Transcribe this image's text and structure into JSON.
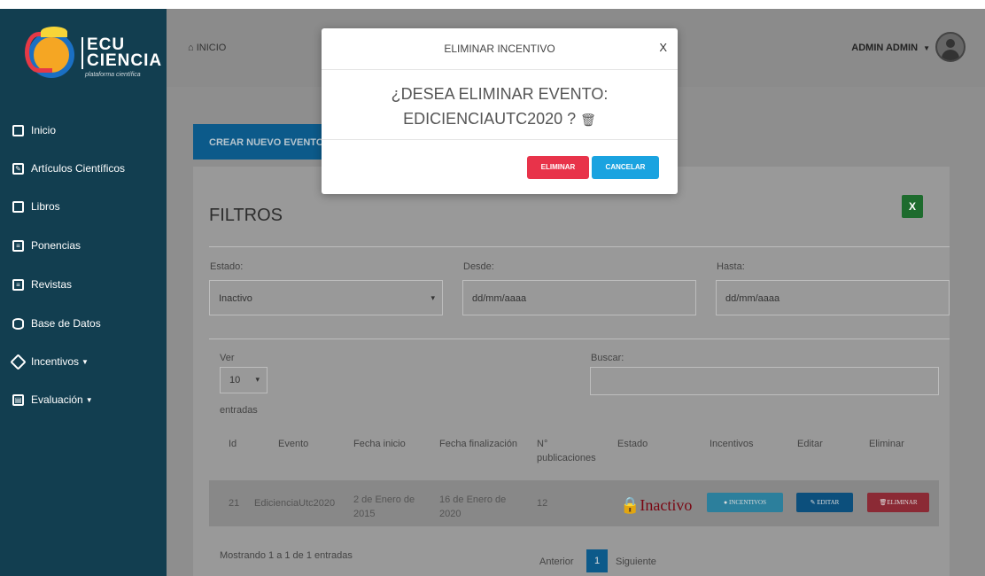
{
  "sidebar": {
    "logo_text": "ECU\nCIENCIA",
    "logo_sub": "plataforma científica",
    "items": [
      {
        "label": "Inicio",
        "icon": "square-icon"
      },
      {
        "label": "Artículos Científicos",
        "icon": "edit-icon"
      },
      {
        "label": "Libros",
        "icon": "book-icon"
      },
      {
        "label": "Ponencias",
        "icon": "newspaper-icon"
      },
      {
        "label": "Revistas",
        "icon": "document-icon"
      },
      {
        "label": "Base de Datos",
        "icon": "database-icon"
      },
      {
        "label": "Incentivos",
        "icon": "tag-icon"
      },
      {
        "label": "Evaluación",
        "icon": "clipboard-icon"
      }
    ]
  },
  "topbar": {
    "home": "INICIO",
    "user": "ADMIN ADMIN"
  },
  "main": {
    "create_button": "CREAR NUEVO EVENTO",
    "filters_title": "FILTROS",
    "estado_label": "Estado:",
    "estado_value": "Inactivo",
    "desde_label": "Desde:",
    "desde_placeholder": "dd/mm/aaaa",
    "hasta_label": "Hasta:",
    "hasta_placeholder": "dd/mm/aaaa",
    "ver_label": "Ver",
    "ver_value": "10",
    "entradas_label": "entradas",
    "buscar_label": "Buscar:"
  },
  "table": {
    "headers": [
      "Id",
      "Evento",
      "Fecha inicio",
      "Fecha finalización",
      "N°\npublicaciones",
      "Estado",
      "Incentivos",
      "Editar",
      "Eliminar"
    ],
    "row": {
      "id": "21",
      "evento": "EdicienciaUtc2020",
      "inicio": "2 de Enero de\n2015",
      "fin": "16 de Enero de\n2020",
      "publicaciones": "12",
      "estado": "Inactivo",
      "incentivos_btn": "INCENTIVOS",
      "editar_btn": "EDITAR",
      "eliminar_btn": "ELIMINAR"
    },
    "info": "Mostrando 1 a 1 de 1 entradas",
    "prev": "Anterior",
    "page": "1",
    "next": "Siguiente"
  },
  "modal": {
    "title": "ELIMINAR INCENTIVO",
    "close": "X",
    "question_line1": "¿DESEA ELIMINAR EVENTO:",
    "question_line2": "EDICIENCIAUTC2020 ?",
    "delete_button": "ELIMINAR",
    "cancel_button": "CANCELAR"
  },
  "colors": {
    "sidebar": "#123e50",
    "delete": "#e8334a",
    "cancel": "#1aa3e0",
    "inactive_text": "#7a0612"
  }
}
